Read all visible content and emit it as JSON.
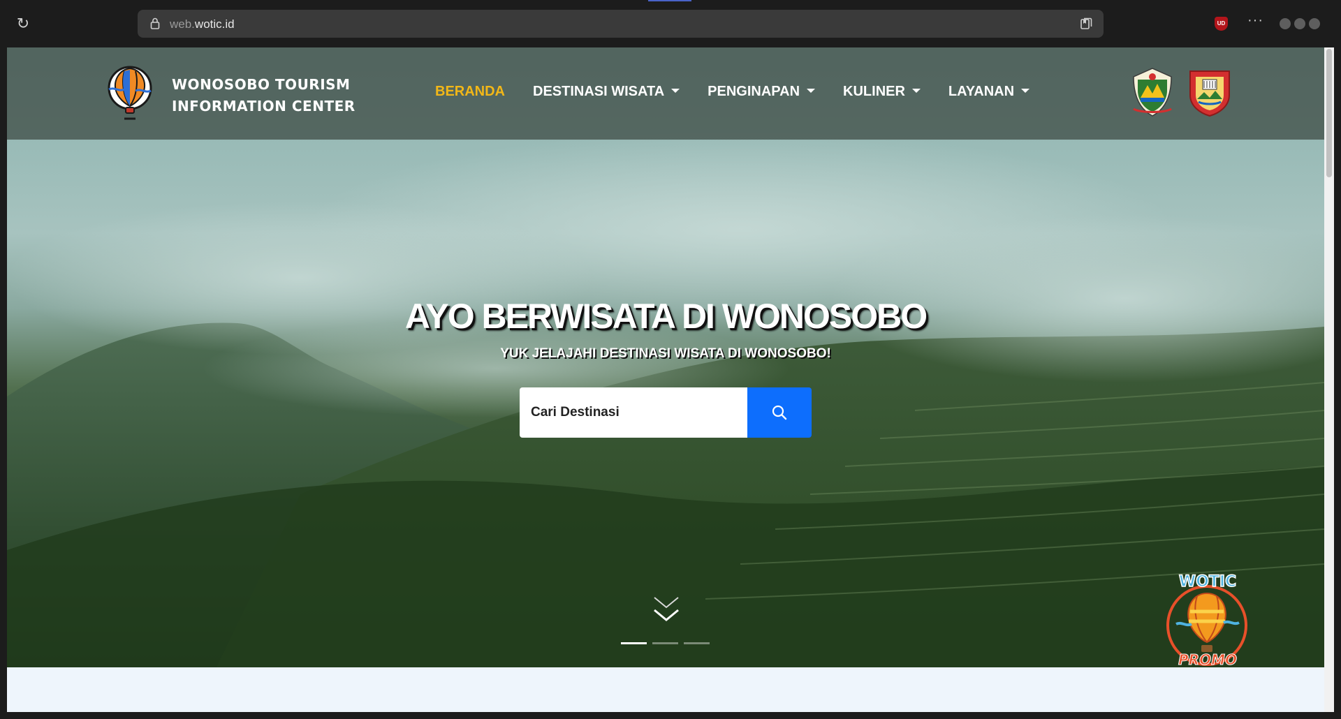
{
  "browser": {
    "url_prefix": "web.",
    "url_domain": "wotic.id",
    "ublock_label": "UD",
    "more_label": "···"
  },
  "site": {
    "brand_line1": "WONOSOBO TOURISM",
    "brand_line2": "INFORMATION CENTER",
    "menu": [
      {
        "label": "BERANDA",
        "active": true,
        "dropdown": false
      },
      {
        "label": "DESTINASI WISATA",
        "active": false,
        "dropdown": true
      },
      {
        "label": "PENGINAPAN",
        "active": false,
        "dropdown": true
      },
      {
        "label": "KULINER",
        "active": false,
        "dropdown": true
      },
      {
        "label": "LAYANAN",
        "active": false,
        "dropdown": true
      }
    ]
  },
  "hero": {
    "title": "AYO BERWISATA DI WONOSOBO",
    "subtitle": "YUK JELAJAHI DESTINASI WISATA DI WONOSOBO!",
    "search_placeholder": "Cari Destinasi",
    "slides_total": 3,
    "slide_active": 1,
    "promo_top": "WOTIC",
    "promo_bottom": "PROMO"
  },
  "colors": {
    "active_menu": "#f2b718",
    "search_button": "#0d6efd",
    "below_section": "#eef5fc"
  }
}
